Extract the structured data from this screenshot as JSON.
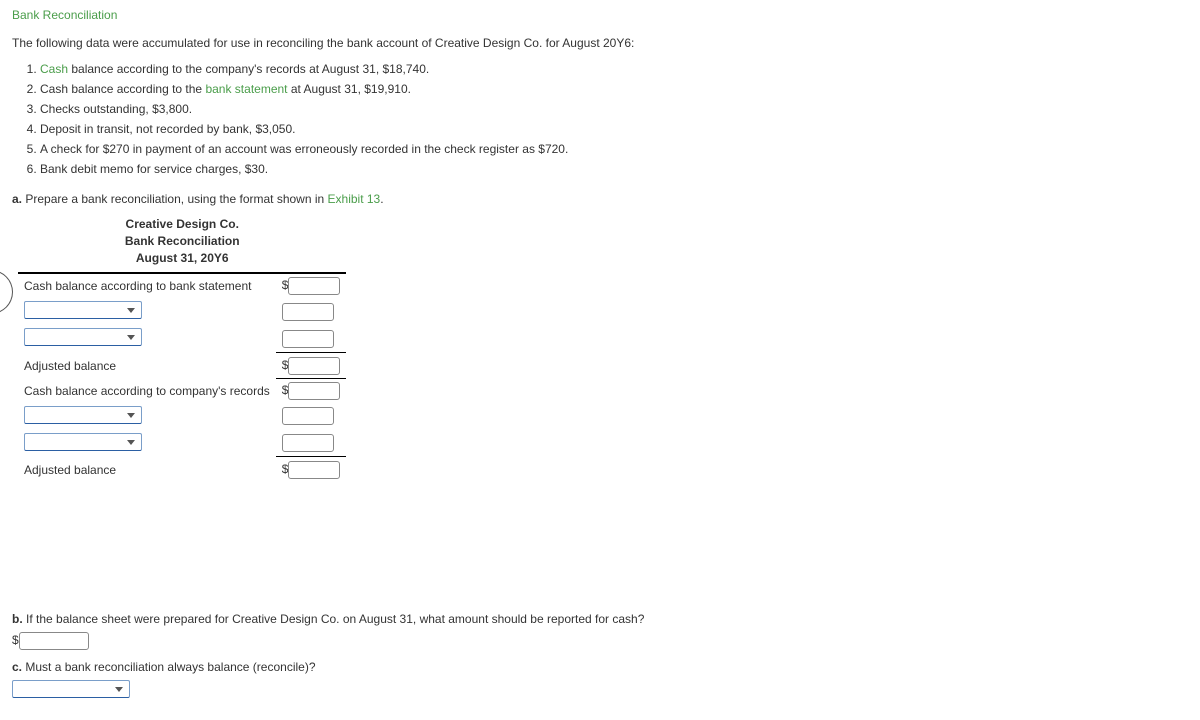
{
  "title": "Bank Reconciliation",
  "intro": "The following data were accumulated for use in reconciling the bank account of Creative Design Co. for August 20Y6:",
  "items": {
    "i1a": "Cash",
    "i1b": " balance according to the company's records at August 31, $18,740.",
    "i2a": "Cash balance according to the ",
    "i2b": "bank statement",
    "i2c": " at August 31, $19,910.",
    "i3": "Checks outstanding, $3,800.",
    "i4": "Deposit in transit, not recorded by bank, $3,050.",
    "i5": "A check for $270 in payment of an account was erroneously recorded in the check register as $720.",
    "i6": "Bank debit memo for service charges, $30."
  },
  "partA": {
    "label": "a.",
    "textA": "  Prepare a bank reconciliation, using the format shown in ",
    "link": "Exhibit 13",
    "textB": "."
  },
  "header": {
    "line1": "Creative Design Co.",
    "line2": "Bank Reconciliation",
    "line3": "August 31, 20Y6"
  },
  "rows": {
    "bankStmt": "Cash balance according to bank statement",
    "adjBal": "Adjusted balance",
    "compRec": "Cash balance according to company's records"
  },
  "partB": {
    "label": "b.",
    "text": "  If the balance sheet were prepared for Creative Design Co. on August 31, what amount should be reported for cash?"
  },
  "partC": {
    "label": "c.",
    "text": "  Must a bank reconciliation always balance (reconcile)?"
  },
  "dollar": "$"
}
